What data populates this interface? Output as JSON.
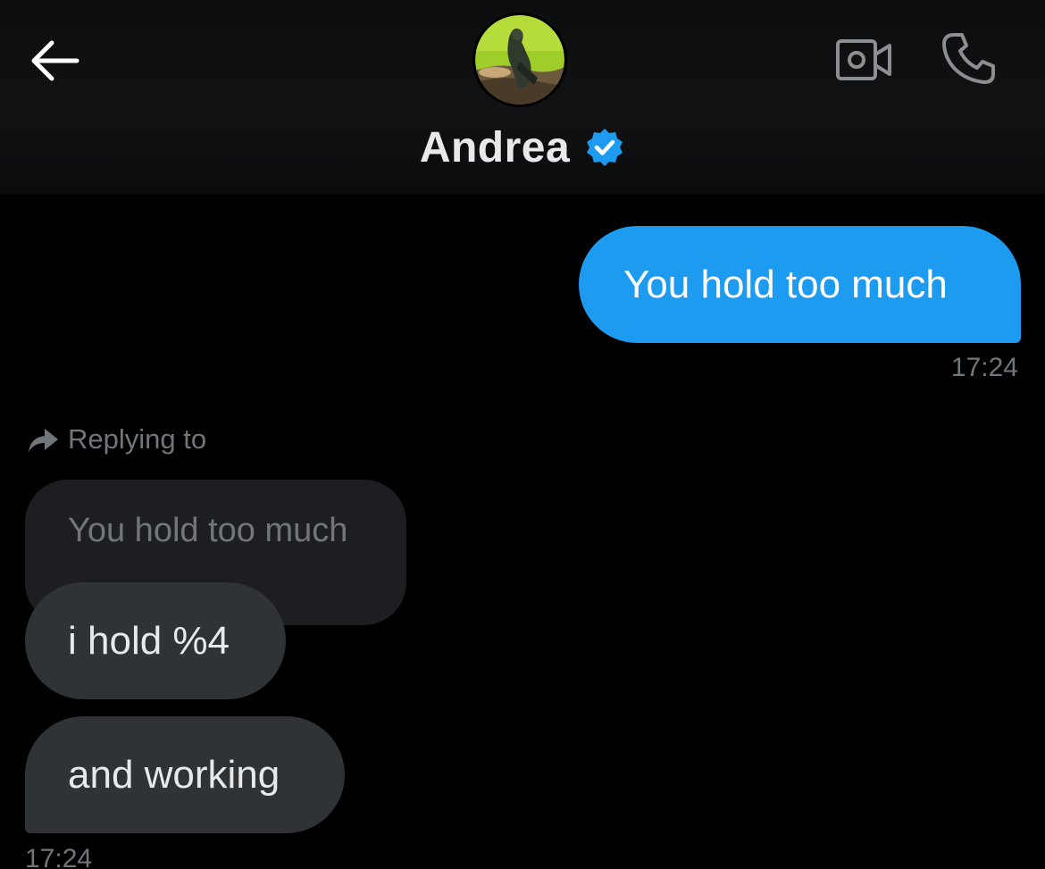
{
  "header": {
    "contact_name": "Andrea",
    "verified": true,
    "icons": {
      "back": "back-arrow-icon",
      "video": "video-call-icon",
      "phone": "phone-call-icon",
      "verified": "verified-badge-icon"
    },
    "colors": {
      "verified_badge": "#1d9bf0"
    }
  },
  "messages": {
    "sent": {
      "text": "You hold too much",
      "time": "17:24",
      "bubble_color": "#1d9bf0"
    },
    "received": {
      "replying_label": "Replying to",
      "quoted_text": "You hold too much",
      "items": [
        {
          "text": "i hold %4"
        },
        {
          "text": "and working"
        }
      ],
      "time": "17:24",
      "bubble_color": "#2f3336"
    }
  }
}
